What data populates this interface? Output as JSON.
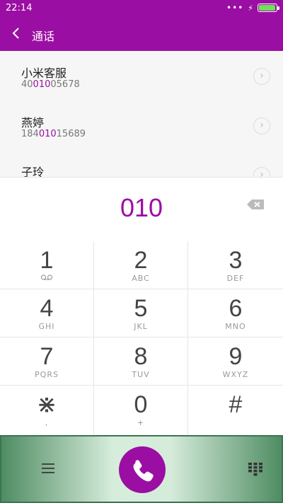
{
  "status": {
    "time": "22:14",
    "signal_dots": "•••",
    "battery_level_percent": 95
  },
  "header": {
    "title": "通话"
  },
  "results": [
    {
      "name": "小米客服",
      "num_pre": "40",
      "num_match": "010",
      "num_post": "05678"
    },
    {
      "name": "燕婷",
      "num_pre": "184",
      "num_match": "010",
      "num_post": "15689"
    },
    {
      "name": "子玲",
      "num_pre": "",
      "num_match": "",
      "num_post": ""
    }
  ],
  "dialer": {
    "entry": "010"
  },
  "keys": [
    {
      "digit": "1",
      "letters": ""
    },
    {
      "digit": "2",
      "letters": "ABC"
    },
    {
      "digit": "3",
      "letters": "DEF"
    },
    {
      "digit": "4",
      "letters": "GHI"
    },
    {
      "digit": "5",
      "letters": "JKL"
    },
    {
      "digit": "6",
      "letters": "MNO"
    },
    {
      "digit": "7",
      "letters": "PQRS"
    },
    {
      "digit": "8",
      "letters": "TUV"
    },
    {
      "digit": "9",
      "letters": "WXYZ"
    },
    {
      "digit": "⋇",
      "letters": ","
    },
    {
      "digit": "0",
      "letters": "+"
    },
    {
      "digit": "#",
      "letters": ""
    }
  ],
  "icons": {
    "back": "chevron-left-icon",
    "backspace": "backspace-icon",
    "voicemail": "voicemail-icon",
    "menu": "menu-icon",
    "call": "phone-icon",
    "keypad_toggle": "dialpad-icon"
  },
  "colors": {
    "accent": "#9b0ea3",
    "battery": "#71e05b"
  }
}
